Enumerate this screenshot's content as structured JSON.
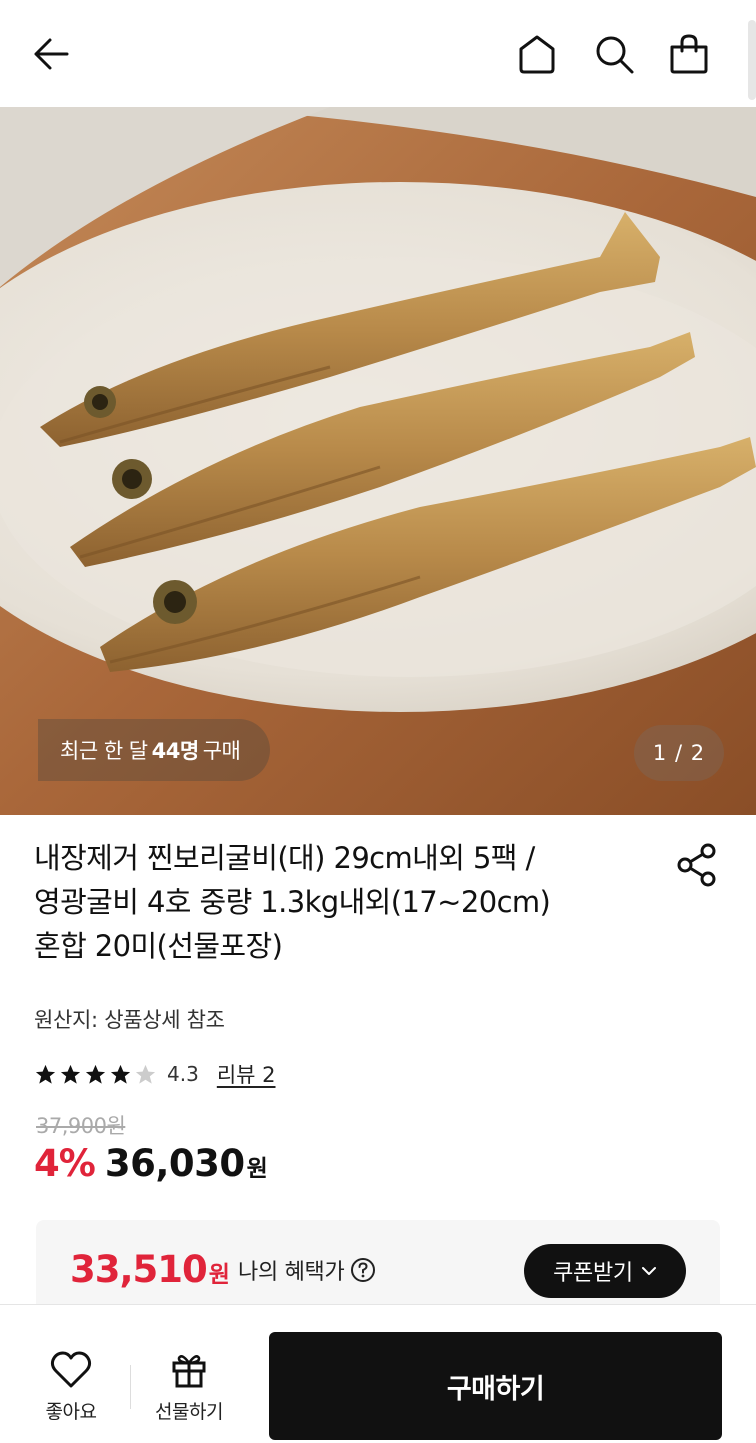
{
  "header": {
    "icons": [
      "back-arrow-icon",
      "home-icon",
      "search-icon",
      "shopping-bag-icon"
    ]
  },
  "hero": {
    "recent_prefix": "최근 한 달",
    "recent_count": "44명",
    "recent_suffix": "구매",
    "page_counter": "1 / 2"
  },
  "product": {
    "title_lines": [
      "내장제거 찐보리굴비(대) 29cm내외 5팩 /",
      "영광굴비 4호 중량 1.3kg내외(17~20cm)",
      "혼합 20미(선물포장)"
    ],
    "origin": "원산지: 상품상세 참조",
    "rating": 4.3,
    "rating_text": "4.3",
    "review_label": "리뷰 2",
    "original_price": "37,900원",
    "discount": "4%",
    "price": "36,030",
    "currency": "원"
  },
  "benefit": {
    "price": "33,510",
    "currency": "원",
    "label": "나의 혜택가",
    "coupon_button": "쿠폰받기"
  },
  "bottom_bar": {
    "like_label": "좋아요",
    "gift_label": "선물하기",
    "buy_label": "구매하기"
  },
  "colors": {
    "accent_red": "#e0243a",
    "primary_dark": "#111111",
    "star": "#111111",
    "star_empty": "#cccccc"
  }
}
